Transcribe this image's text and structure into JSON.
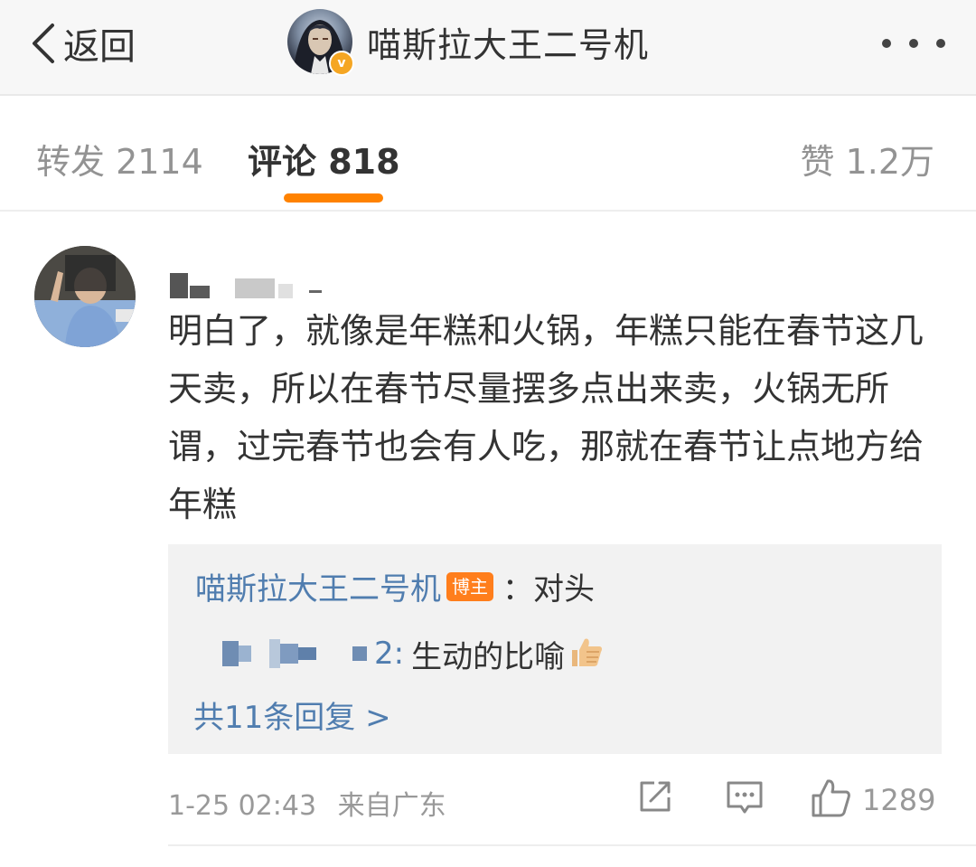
{
  "topbar": {
    "back_label": "返回",
    "title": "喵斯拉大王二号机",
    "verified_badge": "v"
  },
  "tabs": [
    {
      "label": "转发 2114",
      "active": false
    },
    {
      "label": "评论 818",
      "active": true
    },
    {
      "label": "赞 1.2万",
      "active": false
    }
  ],
  "accent_color": "#ff8200",
  "link_color": "#507daf",
  "comment": {
    "text": "明白了，就像是年糕和火锅，年糕只能在春节这几天卖，所以在春节尽量摆多点出来卖，火锅无所谓，过完春节也会有人吃，那就在春节让点地方给年糕",
    "replies": [
      {
        "author": "喵斯拉大王二号机",
        "tag": "博主",
        "text": "：对头"
      },
      {
        "author_suffix": "2:",
        "text": "生动的比喻",
        "emoji": "thumbs-up-emoji"
      }
    ],
    "more_replies": "共11条回复 >",
    "timestamp": "1-25 02:43",
    "location": "来自广东",
    "like_count": "1289"
  }
}
